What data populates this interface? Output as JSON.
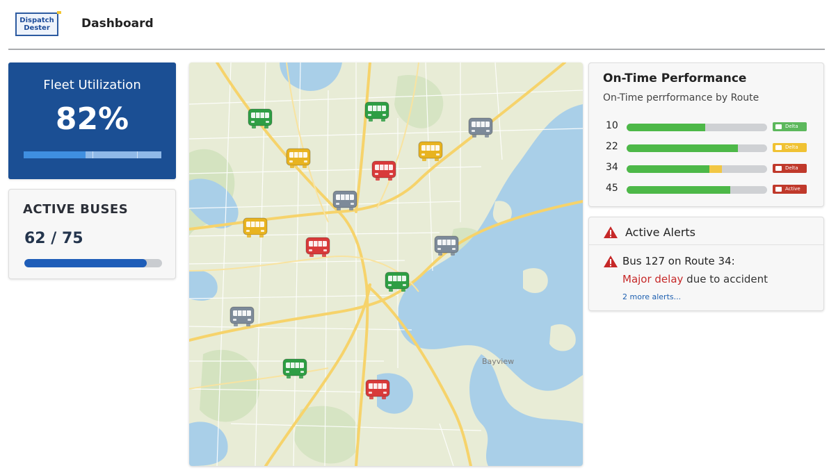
{
  "app": {
    "logo_line1": "Dispatch",
    "logo_line2": "Dester",
    "page_title": "Dashboard"
  },
  "fleet_utilization": {
    "title": "Fleet Utilization",
    "value": "82%",
    "fraction": 0.45
  },
  "active_buses": {
    "title": "ACTIVE BUSES",
    "value": "62 / 75",
    "fraction": 0.89
  },
  "map": {
    "labels": [
      "Bayview"
    ],
    "markers": [
      {
        "color": "green"
      },
      {
        "color": "green"
      },
      {
        "color": "gray"
      },
      {
        "color": "yellow"
      },
      {
        "color": "yellow"
      },
      {
        "color": "red"
      },
      {
        "color": "gray"
      },
      {
        "color": "yellow"
      },
      {
        "color": "red"
      },
      {
        "color": "gray"
      },
      {
        "color": "green"
      },
      {
        "color": "gray"
      },
      {
        "color": "green"
      },
      {
        "color": "red"
      }
    ]
  },
  "on_time_performance": {
    "title": "On-Time Performance",
    "subtitle": "On-Time perrformance by Route",
    "rows": [
      {
        "route": "10",
        "green": 0.56,
        "yellow": 0.0,
        "badge": "Delta",
        "badge_color": "#5cb85c"
      },
      {
        "route": "22",
        "green": 0.79,
        "yellow": 0.0,
        "badge": "Delta",
        "badge_color": "#f0c233"
      },
      {
        "route": "34",
        "green": 0.59,
        "yellow": 0.09,
        "badge": "Delta",
        "badge_color": "#c0392b"
      },
      {
        "route": "45",
        "green": 0.74,
        "yellow": 0.0,
        "badge": "Active",
        "badge_color": "#c0392b"
      }
    ]
  },
  "alerts": {
    "title": "Active Alerts",
    "alert_line1": "Bus 127 on Route 34:",
    "alert_highlight": "Major delay",
    "alert_rest": " due to accident",
    "more_link": "2 more alerts..."
  },
  "colors": {
    "brand_blue": "#1b4f94",
    "bar_green": "#4db848",
    "bar_yellow": "#f2c744",
    "alert_red": "#c62828",
    "bus_green": "#2e9e44",
    "bus_yellow": "#e8b320",
    "bus_red": "#d83a3a",
    "bus_gray": "#7d8a99"
  },
  "icons": [
    "warning-triangle-icon",
    "bus-icon"
  ]
}
